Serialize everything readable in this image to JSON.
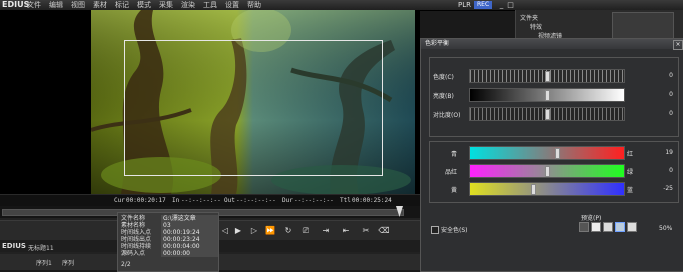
{
  "app": {
    "name": "EDIUS"
  },
  "menu": [
    "文件",
    "编辑",
    "视图",
    "素材",
    "标记",
    "模式",
    "采集",
    "渲染",
    "工具",
    "设置",
    "帮助"
  ],
  "player": {
    "mode_label": "PLR",
    "rec_label": "REC"
  },
  "window_controls": [
    "_",
    "□",
    "×"
  ],
  "timecodes": {
    "cur_label": "Cur",
    "cur_value": "00:00:20:17",
    "in_label": "In",
    "in_value": "--:--:--:--",
    "out_label": "Out",
    "out_value": "--:--:--:--",
    "dur_label": "Dur",
    "dur_value": "--:--:--:--",
    "ttl_label": "Ttl",
    "ttl_value": "00:00:25:24"
  },
  "bin": {
    "header": "文件夹",
    "item1": "特效",
    "item2": "视频滤镜"
  },
  "dialog": {
    "title": "色彩平衡",
    "sliders_top": [
      {
        "label": "色度(C)",
        "value": "0"
      },
      {
        "label": "亮度(B)",
        "value": "0"
      },
      {
        "label": "对比度(O)",
        "value": "0"
      }
    ],
    "sliders_color": [
      {
        "left": "青",
        "right": "红",
        "value": "19"
      },
      {
        "left": "品红",
        "right": "绿",
        "value": "0"
      },
      {
        "left": "黄",
        "right": "蓝",
        "value": "-25"
      }
    ],
    "safe_color_label": "安全色(S)",
    "preview_label": "预览(P)",
    "preview_percent": "50%"
  },
  "info_panel": {
    "rows": [
      {
        "k": "文件名称",
        "v": "G:\\漂这文章"
      },
      {
        "k": "素材名称",
        "v": "03"
      },
      {
        "k": "时间线入点",
        "v": "00:00:19:24"
      },
      {
        "k": "时间线出点",
        "v": "00:00:23:24"
      },
      {
        "k": "时间线持续",
        "v": "00:00:04:00"
      },
      {
        "k": "源码入点",
        "v": "00:00:00"
      }
    ],
    "page": "2/2"
  },
  "timeline": {
    "project_label": "EDIUS",
    "sequence_name": "无标题11",
    "seq_tab1": "序列1",
    "seq_tab2": "序列"
  },
  "colors": {
    "accent": "#3f66c8",
    "bg": "#1a1a1a",
    "dialog": "#2e2f31"
  }
}
